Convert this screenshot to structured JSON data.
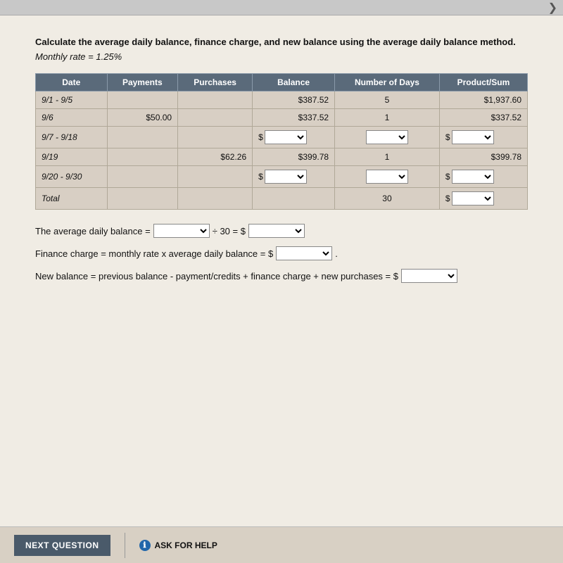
{
  "topbar": {
    "arrow_label": "❯"
  },
  "instruction": {
    "main_text": "Calculate the average daily balance, finance charge, and new balance using the average daily balance method.",
    "monthly_rate": "Monthly rate = 1.25%"
  },
  "table": {
    "headers": [
      "Date",
      "Payments",
      "Purchases",
      "Balance",
      "Number of Days",
      "Product/Sum"
    ],
    "rows": [
      {
        "date": "9/1 - 9/5",
        "payments": "",
        "purchases": "",
        "balance": "$387.52",
        "days": "5",
        "product": "$1,937.60",
        "balance_dropdown": false,
        "days_dropdown": false,
        "product_dropdown": false
      },
      {
        "date": "9/6",
        "payments": "$50.00",
        "purchases": "",
        "balance": "$337.52",
        "days": "1",
        "product": "$337.52",
        "balance_dropdown": false,
        "days_dropdown": false,
        "product_dropdown": false
      },
      {
        "date": "9/7 - 9/18",
        "payments": "",
        "purchases": "",
        "balance": "",
        "days": "",
        "product": "",
        "balance_dropdown": true,
        "days_dropdown": true,
        "product_dropdown": true
      },
      {
        "date": "9/19",
        "payments": "",
        "purchases": "$62.26",
        "balance": "$399.78",
        "days": "1",
        "product": "$399.78",
        "balance_dropdown": false,
        "days_dropdown": false,
        "product_dropdown": false
      },
      {
        "date": "9/20 - 9/30",
        "payments": "",
        "purchases": "",
        "balance": "",
        "days": "",
        "product": "",
        "balance_dropdown": true,
        "days_dropdown": true,
        "product_dropdown": true
      },
      {
        "date": "Total",
        "payments": "",
        "purchases": "",
        "balance": "",
        "days": "30",
        "product": "",
        "balance_dropdown": false,
        "days_dropdown": false,
        "product_dropdown": true
      }
    ]
  },
  "formulas": {
    "avg_daily_balance_label": "The average daily balance =",
    "div30": "÷ 30 = $",
    "finance_charge_label": "Finance charge = monthly rate x average daily balance = $",
    "new_balance_label": "New balance = previous balance - payment/credits + finance charge + new purchases = $"
  },
  "bottom": {
    "next_button": "NEXT QUESTION",
    "ask_help": "ASK FOR HELP"
  }
}
